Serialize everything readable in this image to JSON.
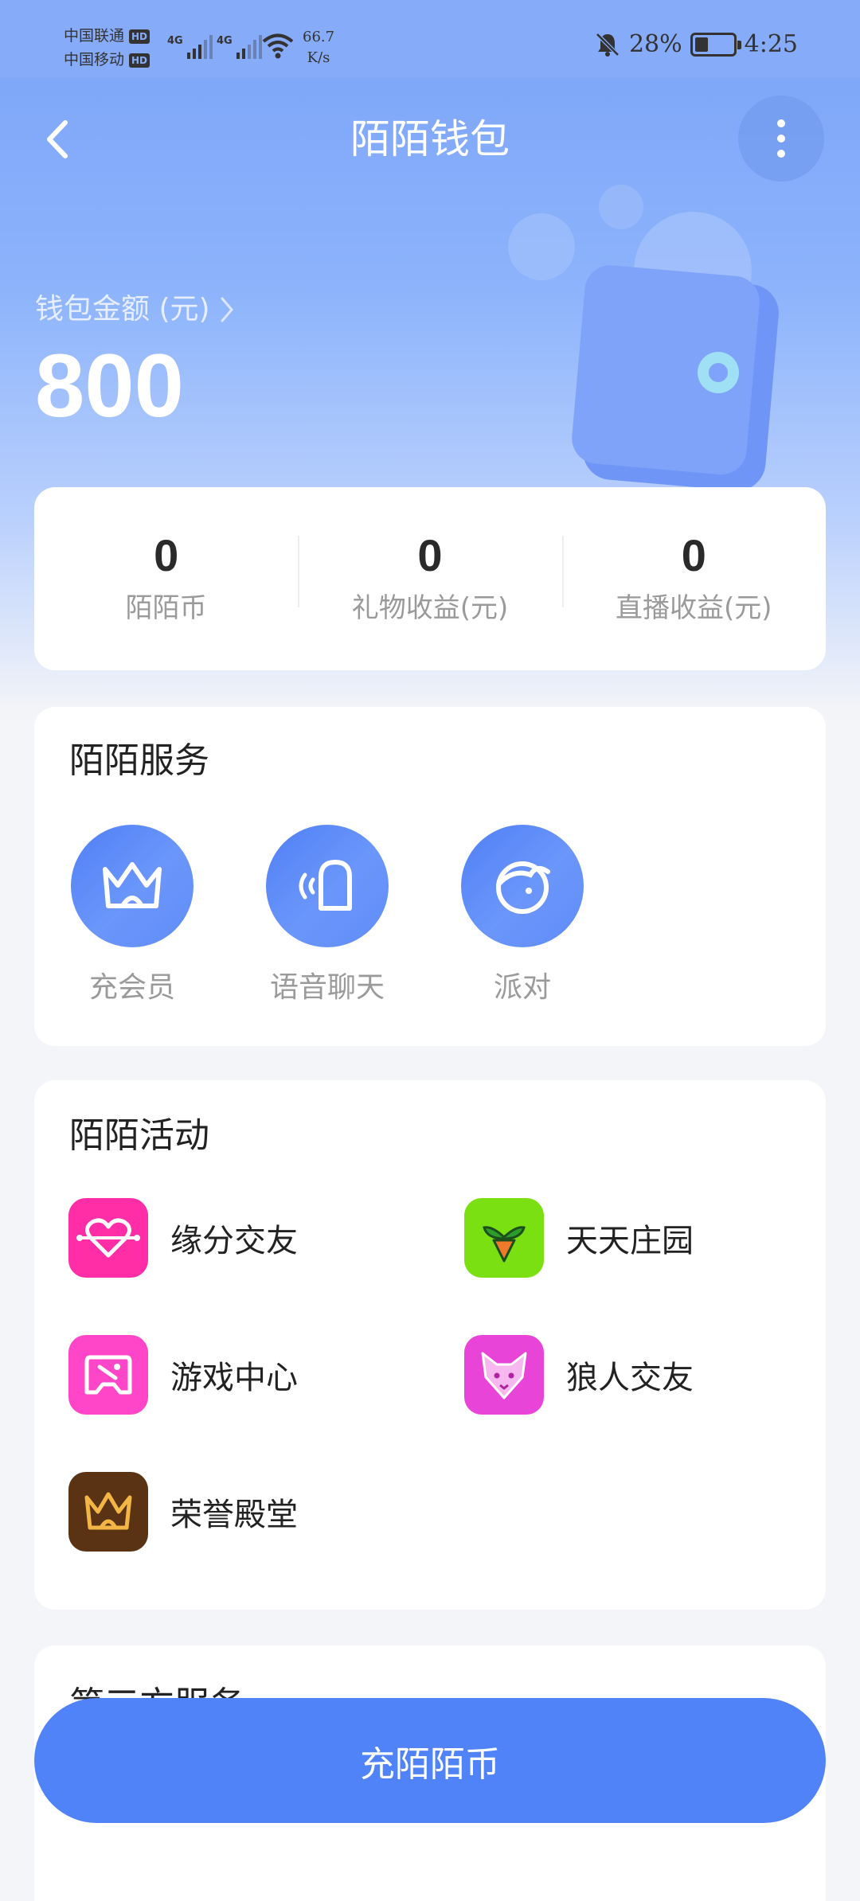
{
  "status_bar": {
    "carrier1": "中国联通",
    "carrier2": "中国移动",
    "hd": "HD",
    "net1": "4G",
    "net2": "4G",
    "speed_value": "66.7",
    "speed_unit": "K/s",
    "battery": "28%",
    "time": "4:25"
  },
  "header": {
    "title": "陌陌钱包"
  },
  "wallet": {
    "label": "钱包金额 (元)",
    "amount": "800"
  },
  "stats": [
    {
      "value": "0",
      "label": "陌陌币"
    },
    {
      "value": "0",
      "label": "礼物收益(元)"
    },
    {
      "value": "0",
      "label": "直播收益(元)"
    }
  ],
  "services": {
    "title": "陌陌服务",
    "items": [
      {
        "label": "充会员",
        "icon": "crown-icon"
      },
      {
        "label": "语音聊天",
        "icon": "voice-chat-icon"
      },
      {
        "label": "派对",
        "icon": "party-icon"
      }
    ]
  },
  "activities": {
    "title": "陌陌活动",
    "items": [
      {
        "label": "缘分交友",
        "icon": "heart-icon",
        "color": "#ff2da6"
      },
      {
        "label": "天天庄园",
        "icon": "sprout-icon",
        "color": "#7be011"
      },
      {
        "label": "游戏中心",
        "icon": "gamepad-icon",
        "color": "#ff46c8"
      },
      {
        "label": "狼人交友",
        "icon": "wolf-icon",
        "color": "#e844d8"
      },
      {
        "label": "荣誉殿堂",
        "icon": "crown-icon",
        "color": "#5a3314"
      }
    ]
  },
  "third_party": {
    "title": "第三方服务"
  },
  "recharge_button": "充陌陌币",
  "colors": {
    "accent": "#4f83f7",
    "hero": "#7aa3f8"
  }
}
